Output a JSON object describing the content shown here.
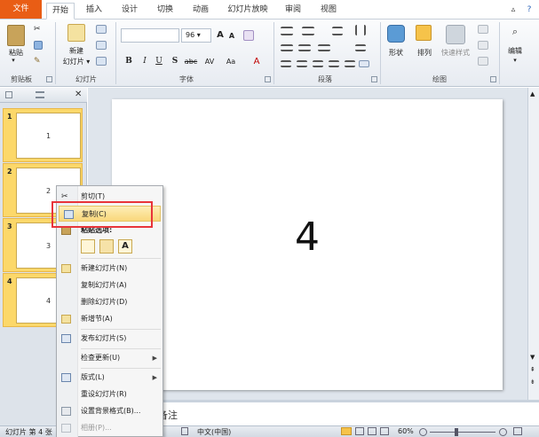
{
  "tabs": {
    "file": "文件",
    "home": "开始",
    "insert": "插入",
    "design": "设计",
    "transitions": "切换",
    "animations": "动画",
    "slideshow": "幻灯片放映",
    "review": "审阅",
    "view": "视图",
    "help_caret": "▵",
    "help": "?"
  },
  "ribbon": {
    "clipboard": {
      "paste": "粘贴",
      "group_label": "剪贴板"
    },
    "slides": {
      "new_slide_1": "新建",
      "new_slide_2": "幻灯片 ▾",
      "group_label": "幻灯片"
    },
    "font": {
      "size": "96",
      "bold": "B",
      "italic": "I",
      "underline": "U",
      "strike": "S",
      "strike_abc": "abc",
      "spacing": "AV",
      "case": "Aa",
      "color": "A",
      "grow": "A",
      "shrink": "A",
      "group_label": "字体"
    },
    "paragraph": {
      "group_label": "段落"
    },
    "drawing": {
      "shapes": "形状",
      "arrange": "排列",
      "quick_styles": "快速样式",
      "group_label": "绘图"
    },
    "editing": {
      "label": "编辑"
    }
  },
  "slides_pane": {
    "thumbnails": [
      {
        "num": "1",
        "text": "1"
      },
      {
        "num": "2",
        "text": "2"
      },
      {
        "num": "3",
        "text": "3"
      },
      {
        "num": "4",
        "text": "4"
      }
    ]
  },
  "slide": {
    "content": "4"
  },
  "notes": {
    "placeholder": "备注"
  },
  "status": {
    "slide_info": "幻灯片 第 4 张",
    "language": "中文(中国)",
    "zoom": "60%"
  },
  "context_menu": {
    "items": [
      {
        "label": "剪切(T)",
        "icon": "scissors-icon"
      },
      {
        "label": "复制(C)",
        "icon": "copy-icon"
      },
      {
        "label": "粘贴选项:",
        "icon": "paste-icon"
      },
      {
        "label": "新建幻灯片(N)",
        "icon": "new-slide-icon"
      },
      {
        "label": "复制幻灯片(A)",
        "icon": ""
      },
      {
        "label": "删除幻灯片(D)",
        "icon": ""
      },
      {
        "label": "新增节(A)",
        "icon": "section-icon"
      },
      {
        "label": "发布幻灯片(S)",
        "icon": "publish-icon"
      },
      {
        "label": "检查更新(U)",
        "icon": ""
      },
      {
        "label": "版式(L)",
        "icon": "layout-icon"
      },
      {
        "label": "重设幻灯片(R)",
        "icon": ""
      },
      {
        "label": "设置背景格式(B)...",
        "icon": "background-icon"
      },
      {
        "label": "相册(P)...",
        "icon": "photo-album-icon"
      }
    ],
    "paste_option_letter": "A"
  },
  "colors": {
    "file_tab": "#e95d15",
    "highlight_box": "#e8343a",
    "selected_thumb": "#fcd86a"
  }
}
